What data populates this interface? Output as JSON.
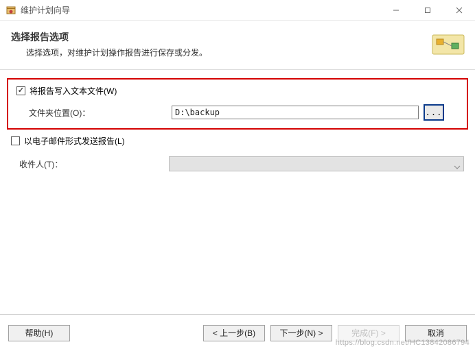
{
  "window": {
    "title": "维护计划向导"
  },
  "header": {
    "title": "选择报告选项",
    "subtitle": "选择选项，对维护计划操作报告进行保存或分发。"
  },
  "form": {
    "write_report": {
      "label": "将报告写入文本文件(W)",
      "checked": true
    },
    "folder": {
      "label": "文件夹位置(O)：",
      "value": "D:\\backup",
      "browse_label": "..."
    },
    "email_report": {
      "label": "以电子邮件形式发送报告(L)",
      "checked": false
    },
    "recipient": {
      "label": "收件人(T)：",
      "value": ""
    }
  },
  "buttons": {
    "help": "帮助(H)",
    "back": "< 上一步(B)",
    "next": "下一步(N) >",
    "finish": "完成(F) >",
    "cancel": "取消"
  },
  "watermark": "https://blog.csdn.net/HC13842086794"
}
